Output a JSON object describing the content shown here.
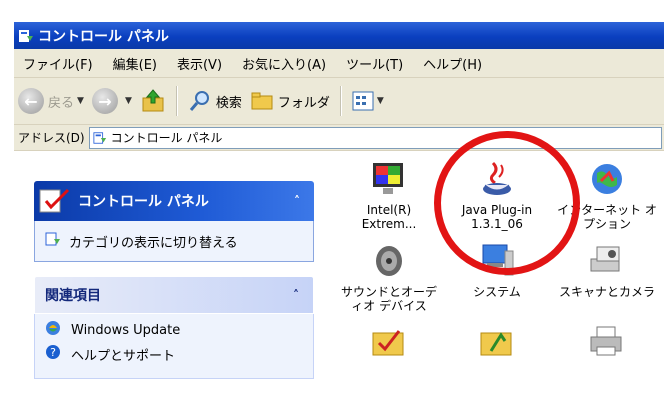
{
  "window": {
    "title": "コントロール パネル"
  },
  "menu": [
    "ファイル(F)",
    "編集(E)",
    "表示(V)",
    "お気に入り(A)",
    "ツール(T)",
    "ヘルプ(H)"
  ],
  "toolbar": {
    "back_label": "戻る",
    "search_label": "検索",
    "folders_label": "フォルダ"
  },
  "address": {
    "label": "アドレス(D)",
    "value": "コントロール パネル"
  },
  "taskpane": {
    "panel1_title": "コントロール パネル",
    "panel1_link": "カテゴリの表示に切り替える",
    "panel2_title": "関連項目",
    "panel2_links": [
      "Windows Update",
      "ヘルプとサポート"
    ]
  },
  "icons": [
    {
      "label": "Intel(R)\nExtrem...",
      "icon": "monitor-icon"
    },
    {
      "label": "Java Plug-in\n1.3.1_06",
      "icon": "java-coffee-icon"
    },
    {
      "label": "インターネット オ\nプション",
      "icon": "globe-icon"
    },
    {
      "label": "サウンドとオーデ\nィオ デバイス",
      "icon": "speaker-icon"
    },
    {
      "label": "システム",
      "icon": "computer-icon"
    },
    {
      "label": "スキャナとカメラ",
      "icon": "scanner-camera-icon"
    },
    {
      "label": "",
      "icon": "folder-check-icon"
    },
    {
      "label": "",
      "icon": "folder-tasks-icon"
    },
    {
      "label": "",
      "icon": "printer-icon"
    }
  ],
  "colors": {
    "title_bar": "#0a3fbf",
    "highlight_circle": "#e21414",
    "task_header": "#1f5bd6"
  }
}
